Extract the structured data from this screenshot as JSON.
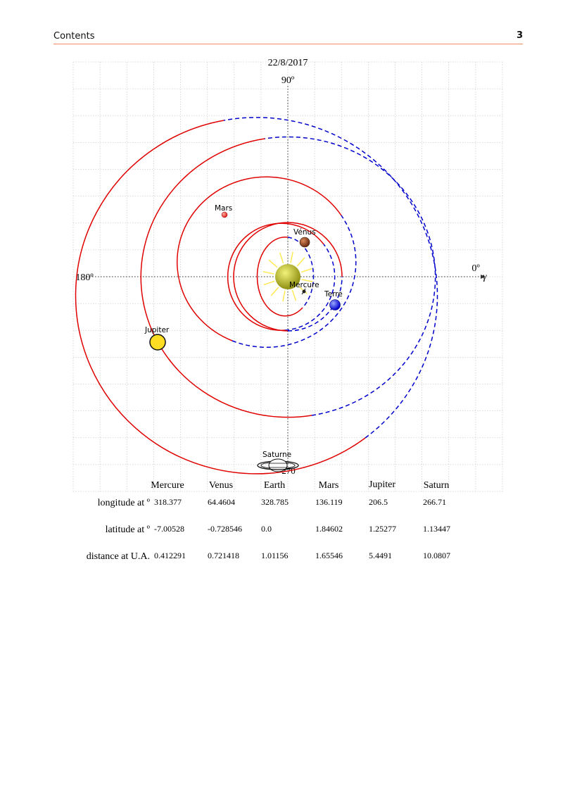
{
  "header": {
    "section": "Contents",
    "page_number": "3"
  },
  "diagram": {
    "date": "22/8/2017",
    "angle_labels": {
      "top": "90º",
      "left": "180º",
      "right": "0º",
      "vernal_symbol": "γ",
      "bottom": "270"
    },
    "colors": {
      "orbit_front": "#e00000",
      "orbit_back": "#0000cc",
      "sun": "#a8a800",
      "sun_rays": "#ffe84a",
      "grid": "#c8c8c8"
    },
    "bodies": [
      {
        "name": "Mercure",
        "label": "Mercure",
        "icon": "mercury-icon"
      },
      {
        "name": "Venus",
        "label": "Vénus",
        "icon": "venus-icon"
      },
      {
        "name": "Terre",
        "label": "Terre",
        "icon": "earth-icon"
      },
      {
        "name": "Mars",
        "label": "Mars",
        "icon": "mars-icon"
      },
      {
        "name": "Jupiter",
        "label": "Jupiter",
        "icon": "jupiter-icon"
      },
      {
        "name": "Saturne",
        "label": "Saturne",
        "icon": "saturn-icon"
      }
    ]
  },
  "table": {
    "columns": [
      "Mercure",
      "Venus",
      "Earth",
      "Mars",
      "Jupiter",
      "Saturn"
    ],
    "rows": [
      {
        "label": "longitude at º",
        "values": [
          "318.377",
          "64.4604",
          "328.785",
          "136.119",
          "206.5",
          "266.71"
        ]
      },
      {
        "label": "latitude at º",
        "values": [
          "-7.00528",
          "-0.728546",
          "0.0",
          "1.84602",
          "1.25277",
          "1.13447"
        ]
      },
      {
        "label": "distance at U.A.",
        "values": [
          "0.412291",
          "0.721418",
          "1.01156",
          "1.65546",
          "5.4491",
          "10.0807"
        ]
      }
    ]
  }
}
